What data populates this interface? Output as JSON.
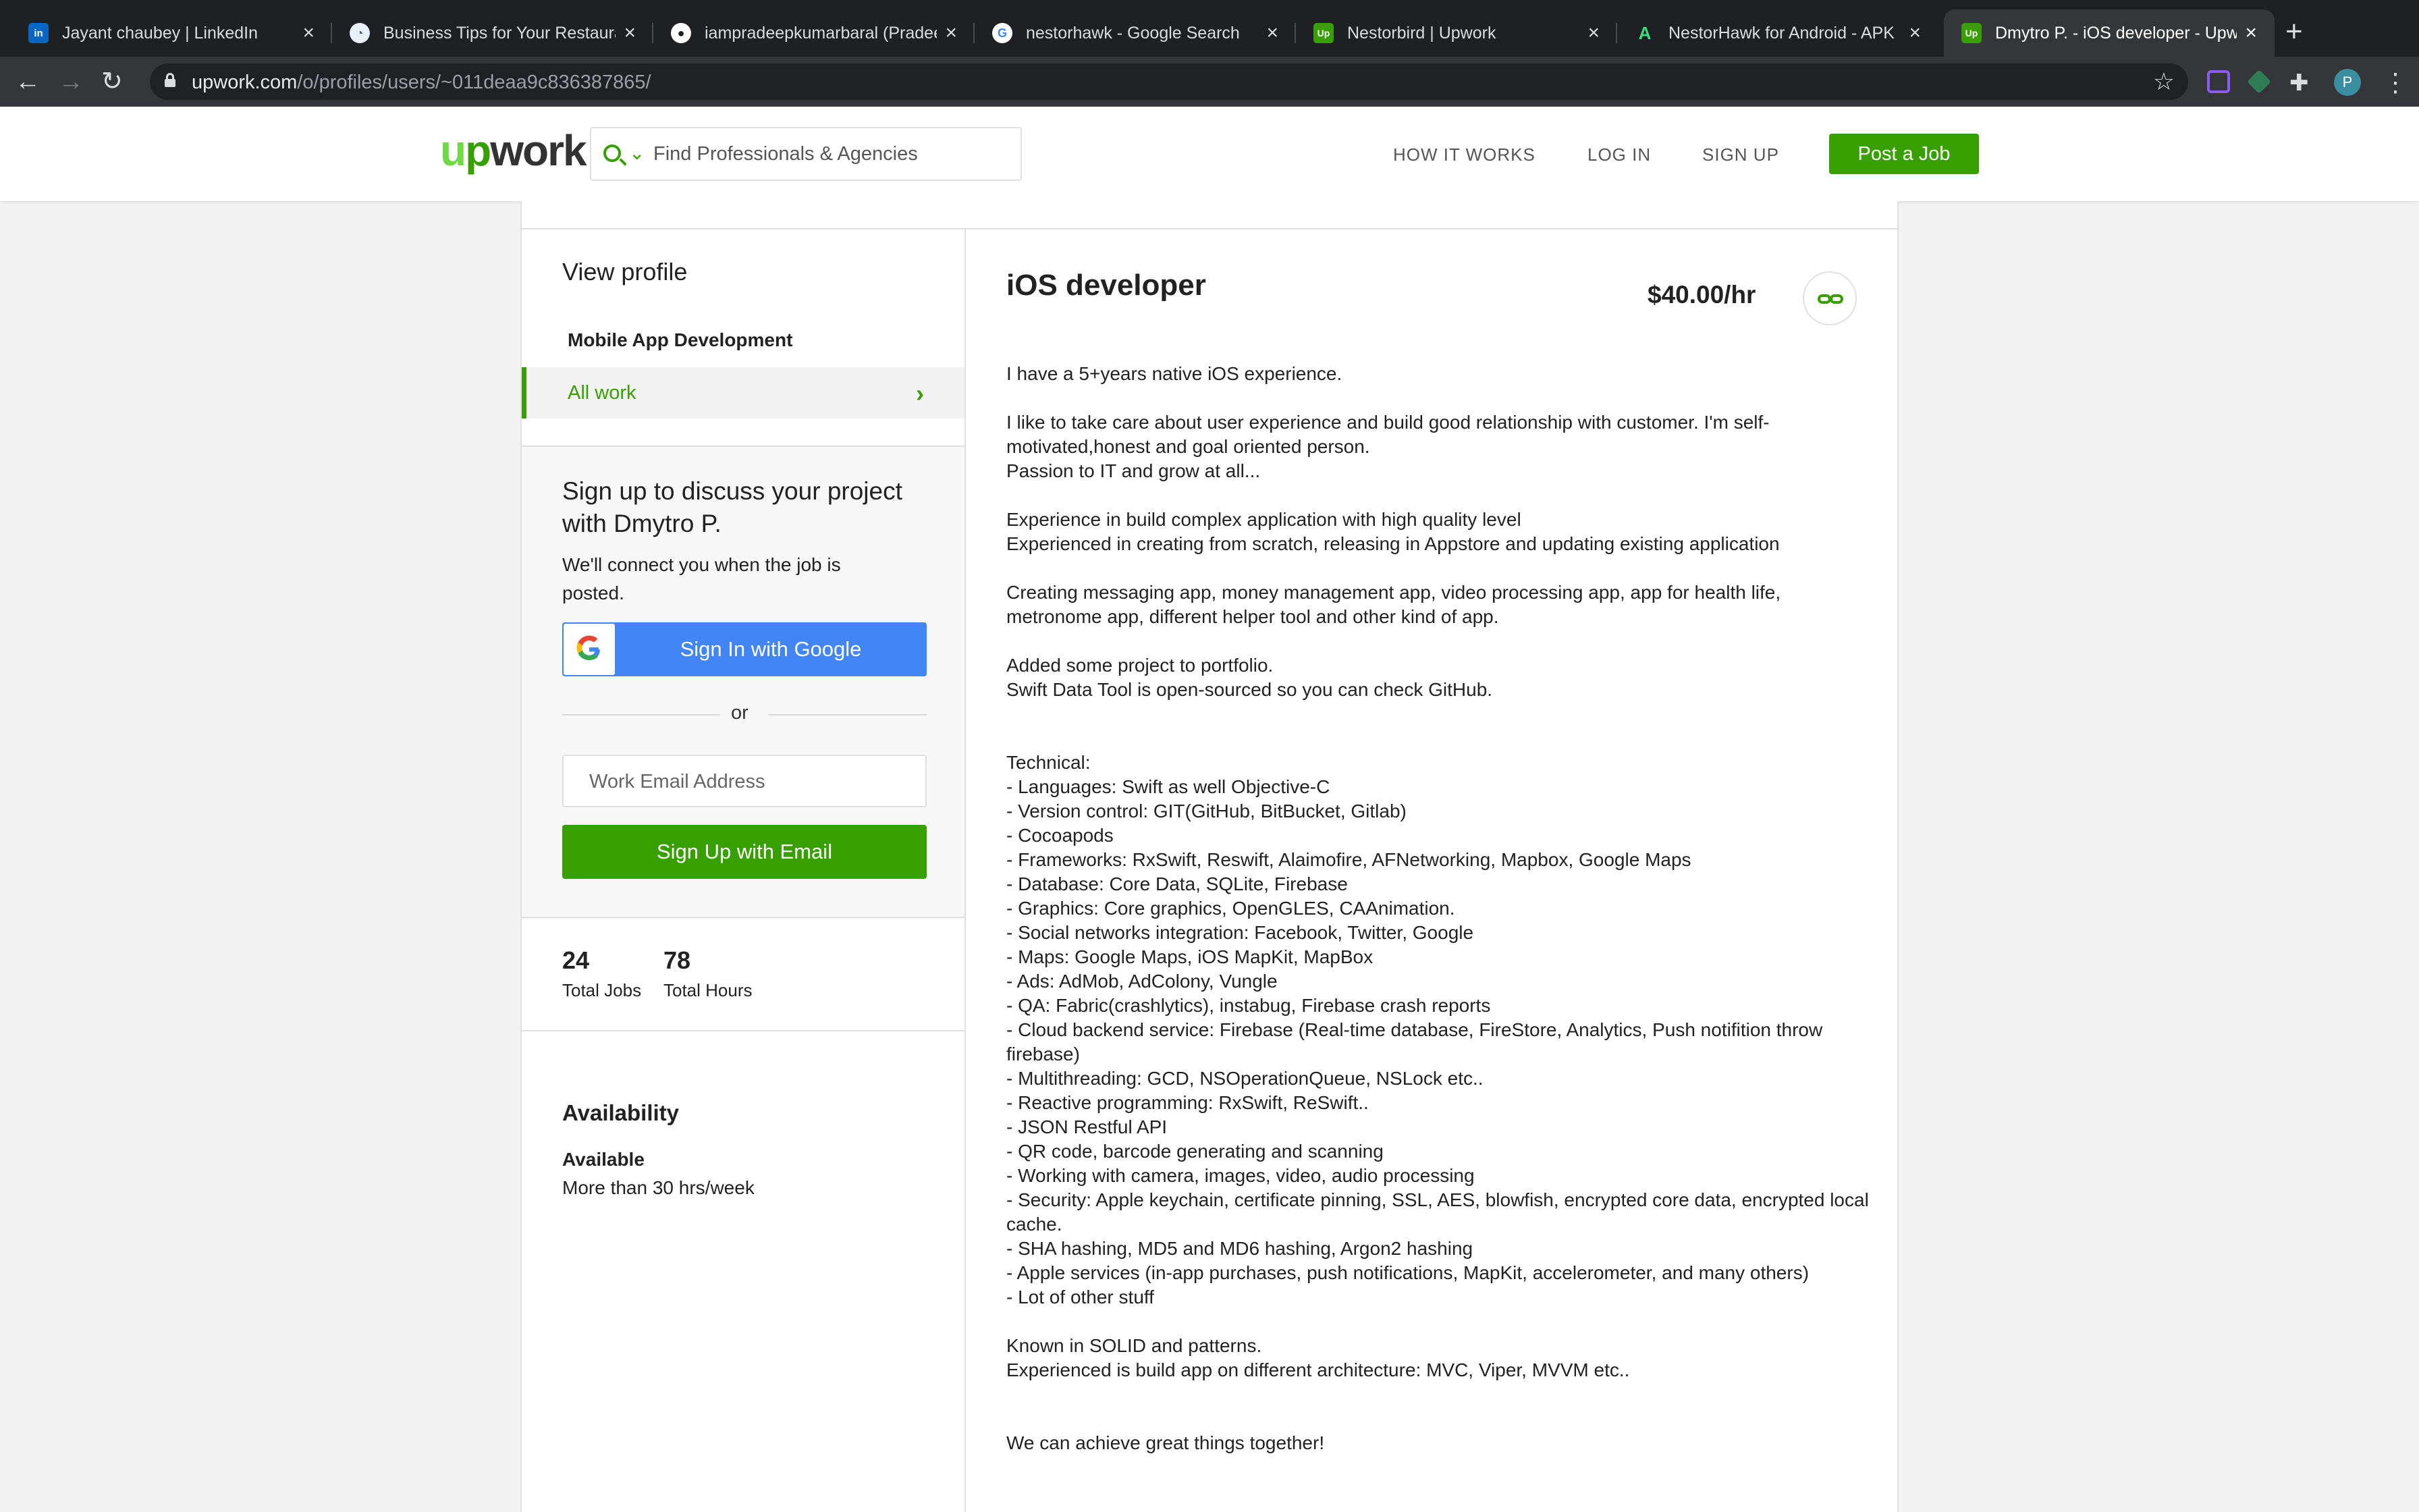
{
  "browser": {
    "tabs": [
      {
        "title": "Jayant chaubey | LinkedIn",
        "icon": "linkedin-icon",
        "color": "#0a66c2",
        "glyph": "in"
      },
      {
        "title": "Business Tips for Your Restaurant",
        "icon": "restaurant-icon",
        "color": "#e8f0fe",
        "glyph": "◔"
      },
      {
        "title": "iampradeepkumarbaral (Pradeep",
        "icon": "github-icon",
        "color": "#ffffff",
        "glyph": "●"
      },
      {
        "title": "nestorhawk - Google Search",
        "icon": "google-icon",
        "color": "#ffffff",
        "glyph": "G"
      },
      {
        "title": "Nestorbird | Upwork",
        "icon": "upwork-icon",
        "color": "#37a000",
        "glyph": "Up"
      },
      {
        "title": "NestorHawk for Android - APK",
        "icon": "apk-icon",
        "color": "#3ddc84",
        "glyph": "A"
      },
      {
        "title": "Dmytro P. - iOS developer - Upwork",
        "icon": "upwork-icon",
        "color": "#37a000",
        "glyph": "Up"
      }
    ],
    "url_host": "upwork.com",
    "url_path": "/o/profiles/users/~011deaa9c836387865/",
    "profile_initial": "P"
  },
  "header": {
    "logo": "upwork",
    "search_placeholder": "Find Professionals & Agencies",
    "nav": [
      "HOW IT WORKS",
      "LOG IN",
      "SIGN UP"
    ],
    "post_job": "Post a Job",
    "accent": "#37a000"
  },
  "sidebar": {
    "view_profile": "View profile",
    "category": "Mobile App Development",
    "all_work": "All work",
    "signup_title": "Sign up to discuss your project with Dmytro P.",
    "signup_sub": "We'll connect you when the job is posted.",
    "google_btn": "Sign In with Google",
    "or": "or",
    "email_placeholder": "Work Email Address",
    "email_btn": "Sign Up with Email",
    "stats": [
      {
        "value": "24",
        "label": "Total Jobs"
      },
      {
        "value": "78",
        "label": "Total Hours"
      }
    ],
    "availability_heading": "Availability",
    "availability_status": "Available",
    "availability_hours": "More than 30 hrs/week"
  },
  "profile": {
    "title": "iOS developer",
    "rate": "$40.00/hr",
    "overview": "I have a 5+years native iOS experience.\n\nI like to take care about user experience and build good relationship with customer. I'm self-motivated,honest and goal oriented person.\nPassion to IT and grow at all...\n\nExperience in build complex application with high quality level\nExperienced in creating from scratch, releasing in Appstore and updating existing application\n\nCreating messaging app, money management app, video processing app, app for health life, metronome app, different helper tool and other kind of app.\n\nAdded some project to portfolio.\nSwift Data Tool is open-sourced so you can check GitHub.\n\n\nTechnical:\n- Languages: Swift as well Objective-C\n- Version control: GIT(GitHub, BitBucket, Gitlab)\n- Cocoapods\n- Frameworks: RxSwift, Reswift, Alaimofire, AFNetworking, Mapbox, Google Maps\n- Database: Core Data, SQLite, Firebase\n- Graphics: Core graphics, OpenGLES, CAAnimation.\n- Social networks integration: Facebook, Twitter, Google\n- Maps: Google Maps, iOS MapKit, MapBox\n- Ads: AdMob, AdColony, Vungle\n- QA: Fabric(crashlytics), instabug, Firebase crash reports\n- Cloud backend service: Firebase (Real-time database, FireStore, Analytics, Push notifition throw firebase)\n- Multithreading: GCD, NSOperationQueue, NSLock etc..\n- Reactive programming: RxSwift, ReSwift..\n- JSON Restful API\n- QR code, barcode generating and scanning\n- Working with camera, images, video, audio processing\n- Security: Apple keychain, certificate pinning, SSL, AES, blowfish, encrypted core data, encrypted local cache.\n- SHA hashing, MD5 and MD6 hashing, Argon2 hashing\n- Apple services (in-app purchases, push notifications, MapKit, accelerometer, and many others)\n- Lot of other stuff\n\nKnown in SOLID and patterns.\nExperienced is build app on different architecture: MVC, Viper, MVVM etc..\n\n\nWe can achieve great things together!"
  }
}
